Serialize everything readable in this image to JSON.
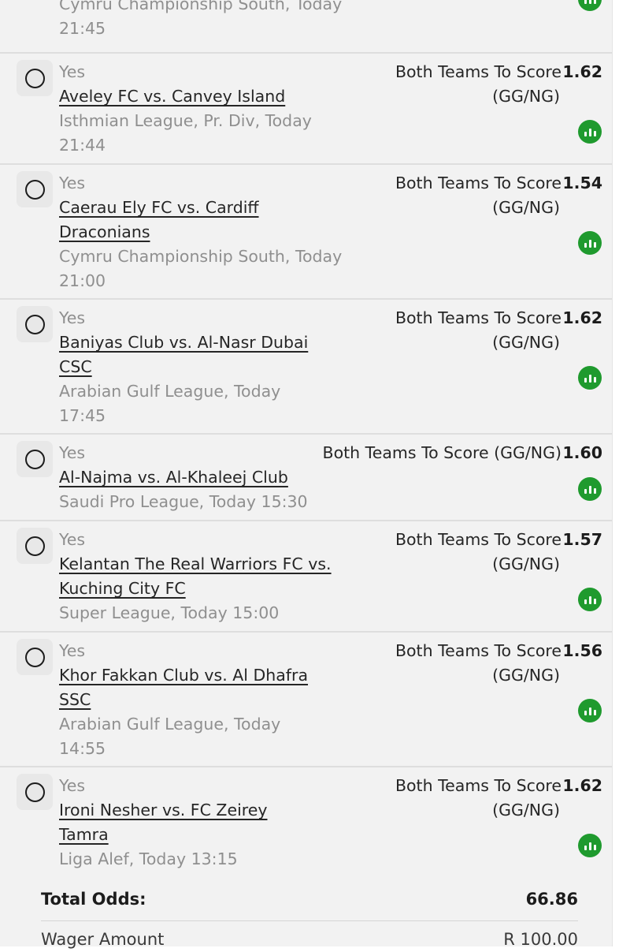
{
  "top_partial": {
    "league": "Cymru Championship South, Today",
    "time": "21:45"
  },
  "bets": [
    {
      "selection": "Yes",
      "match_line1": "Aveley FC vs. Canvey Island",
      "match_line2": "",
      "league": "Isthmian League, Pr. Div, Today",
      "time": "21:44",
      "market_line1": "Both Teams To Score",
      "market_line2": "(GG/NG)",
      "odds": "1.62"
    },
    {
      "selection": "Yes",
      "match_line1": "Caerau Ely FC vs. Cardiff",
      "match_line2": "Draconians",
      "league": "Cymru Championship South, Today",
      "time": "21:00",
      "market_line1": "Both Teams To Score",
      "market_line2": "(GG/NG)",
      "odds": "1.54"
    },
    {
      "selection": "Yes",
      "match_line1": "Baniyas Club vs. Al-Nasr Dubai",
      "match_line2": "CSC",
      "league": "Arabian Gulf League, Today",
      "time": "17:45",
      "market_line1": "Both Teams To Score",
      "market_line2": "(GG/NG)",
      "odds": "1.62"
    },
    {
      "selection": "Yes",
      "match_line1": "Al-Najma vs. Al-Khaleej Club",
      "match_line2": "",
      "league": "Saudi Pro League, Today 15:30",
      "time": "",
      "market_line1": "Both Teams To Score (GG/NG)",
      "market_line2": "",
      "odds": "1.60"
    },
    {
      "selection": "Yes",
      "match_line1": "Kelantan The Real Warriors FC vs.",
      "match_line2": "Kuching City FC",
      "league": "Super League, Today 15:00",
      "time": "",
      "market_line1": "Both Teams To Score",
      "market_line2": "(GG/NG)",
      "odds": "1.57"
    },
    {
      "selection": "Yes",
      "match_line1": "Khor Fakkan Club vs. Al Dhafra",
      "match_line2": "SSC",
      "league": "Arabian Gulf League, Today",
      "time": "14:55",
      "market_line1": "Both Teams To Score",
      "market_line2": "(GG/NG)",
      "odds": "1.56"
    },
    {
      "selection": "Yes",
      "match_line1": "Ironi Nesher vs. FC Zeirey",
      "match_line2": "Tamra",
      "league": "Liga Alef, Today 13:15",
      "time": "",
      "market_line1": "Both Teams To Score",
      "market_line2": "(GG/NG)",
      "odds": "1.62"
    }
  ],
  "summary": {
    "total_odds_label": "Total Odds:",
    "total_odds_value": "66.86",
    "wager_label": "Wager Amount",
    "wager_value": "R 100.00"
  },
  "icons": {
    "radio": "radio-empty-icon",
    "stats": "stats-bar-chart-icon"
  },
  "colors": {
    "stats_green": "#1f9a2e",
    "muted_text": "#8f8f8f",
    "background": "#f2f2f2"
  }
}
